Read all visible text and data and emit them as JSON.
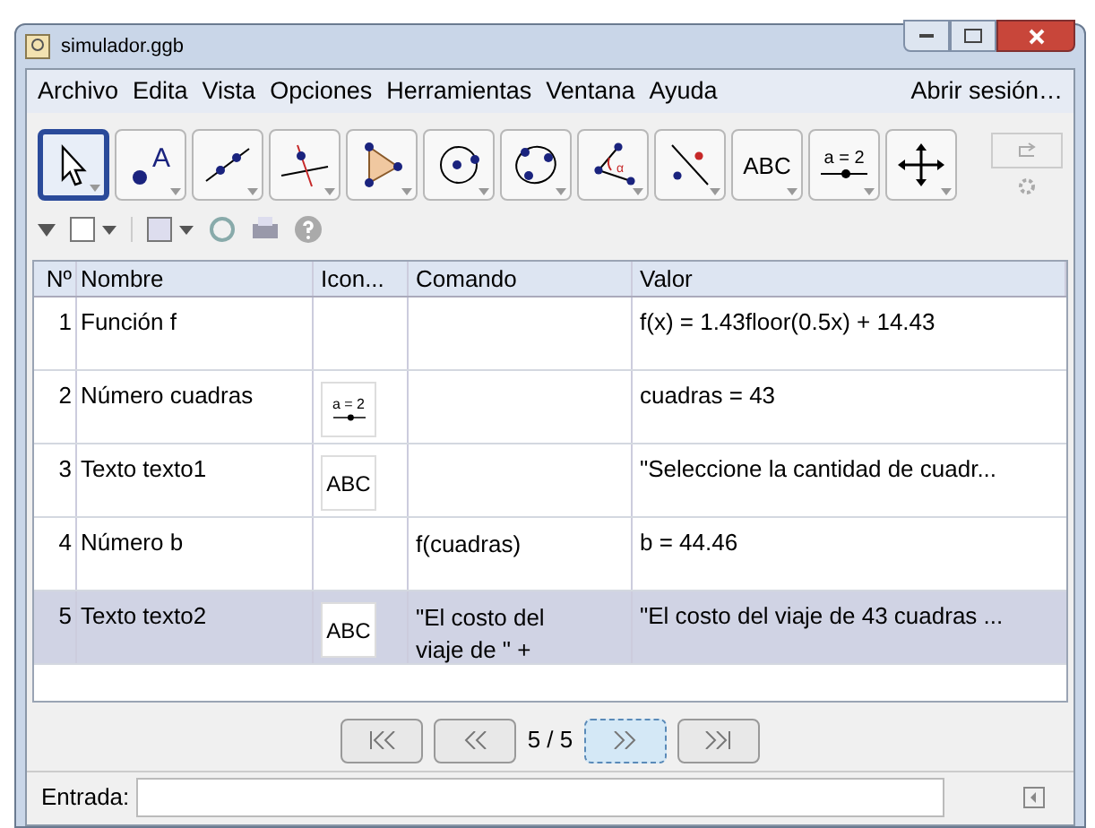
{
  "window": {
    "title": "simulador.ggb"
  },
  "menu": [
    "Archivo",
    "Edita",
    "Vista",
    "Opciones",
    "Herramientas",
    "Ventana",
    "Ayuda"
  ],
  "login": "Abrir sesión…",
  "tools": [
    {
      "kind": "pointer",
      "selected": true
    },
    {
      "kind": "point",
      "label": "A",
      "selected": false
    },
    {
      "kind": "line",
      "selected": false
    },
    {
      "kind": "perpendicular",
      "selected": false
    },
    {
      "kind": "polygon",
      "selected": false
    },
    {
      "kind": "circle",
      "selected": false
    },
    {
      "kind": "conic",
      "selected": false
    },
    {
      "kind": "angle",
      "label": "α",
      "selected": false
    },
    {
      "kind": "reflect",
      "selected": false
    },
    {
      "kind": "text",
      "label": "ABC",
      "selected": false
    },
    {
      "kind": "slider",
      "label": "a = 2",
      "selected": false
    },
    {
      "kind": "move",
      "selected": false
    }
  ],
  "table": {
    "columns": [
      "Nº",
      "Nombre",
      "Icon...",
      "Comando",
      "Valor"
    ],
    "rows": [
      {
        "n": "1",
        "name": "Función f",
        "icon": null,
        "command": "",
        "value": "f(x) = 1.43floor(0.5x) + 14.43",
        "selected": false
      },
      {
        "n": "2",
        "name": "Número cuadras",
        "icon": {
          "kind": "slider",
          "label": "a = 2"
        },
        "command": "",
        "value": "cuadras = 43",
        "selected": false
      },
      {
        "n": "3",
        "name": "Texto texto1",
        "icon": {
          "kind": "text",
          "label": "ABC"
        },
        "command": "",
        "value": "\"Seleccione la cantidad de cuadr...",
        "selected": false
      },
      {
        "n": "4",
        "name": "Número b",
        "icon": null,
        "command": "f(cuadras)",
        "value": "b = 44.46",
        "selected": false
      },
      {
        "n": "5",
        "name": "Texto texto2",
        "icon": {
          "kind": "text",
          "label": "ABC"
        },
        "command": "\"El costo del viaje de \" +",
        "value": "\"El costo del viaje de 43 cuadras ...",
        "selected": true
      }
    ]
  },
  "navigation": {
    "step": "5 / 5"
  },
  "input": {
    "label": "Entrada:"
  }
}
